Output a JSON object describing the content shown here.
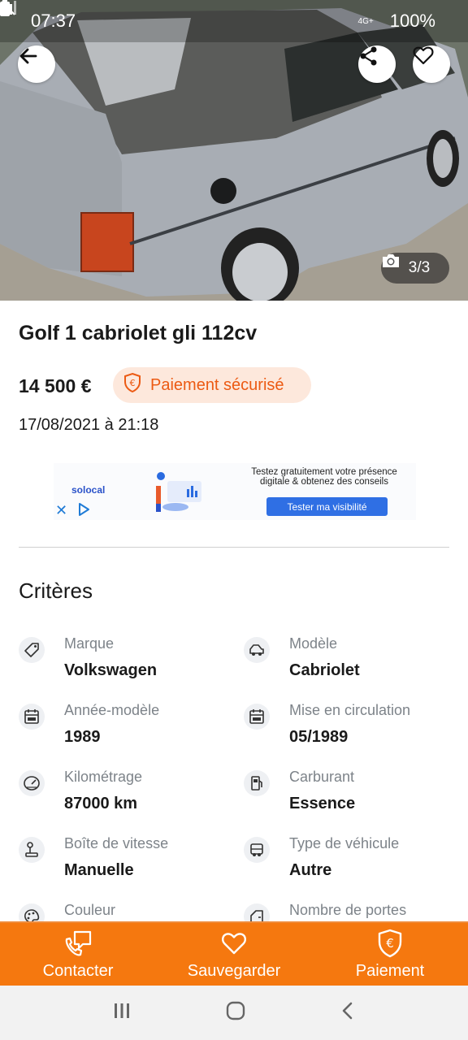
{
  "status_bar": {
    "time": "07:37",
    "network": "4G+",
    "battery": "100%"
  },
  "photo": {
    "counter": "3/3"
  },
  "listing": {
    "title": "Golf 1 cabriolet gli 112cv",
    "price": "14 500 €",
    "secure_payment": "Paiement sécurisé",
    "date": "17/08/2021 à 21:18"
  },
  "ad": {
    "brand": "solocal",
    "text": "Testez gratuitement votre présence digitale & obtenez des conseils",
    "button": "Tester ma visibilité"
  },
  "criteria": {
    "title": "Critères",
    "items": [
      {
        "label": "Marque",
        "value": "Volkswagen",
        "icon": "tag-icon"
      },
      {
        "label": "Modèle",
        "value": "Cabriolet",
        "icon": "car-icon"
      },
      {
        "label": "Année-modèle",
        "value": "1989",
        "icon": "calendar-icon"
      },
      {
        "label": "Mise en circulation",
        "value": "05/1989",
        "icon": "calendar-icon"
      },
      {
        "label": "Kilométrage",
        "value": "87000 km",
        "icon": "speedometer-icon"
      },
      {
        "label": "Carburant",
        "value": "Essence",
        "icon": "fuel-pump-icon"
      },
      {
        "label": "Boîte de vitesse",
        "value": "Manuelle",
        "icon": "gear-stick-icon"
      },
      {
        "label": "Type de véhicule",
        "value": "Autre",
        "icon": "vehicle-type-icon"
      },
      {
        "label": "Couleur",
        "value": "",
        "icon": "palette-icon"
      },
      {
        "label": "Nombre de portes",
        "value": "",
        "icon": "door-icon"
      }
    ]
  },
  "actions": {
    "contact": "Contacter",
    "save": "Sauvegarder",
    "payment": "Paiement"
  },
  "colors": {
    "accent": "#f5780f",
    "secure_bg": "#fde8dc",
    "secure_text": "#ec5a13"
  }
}
